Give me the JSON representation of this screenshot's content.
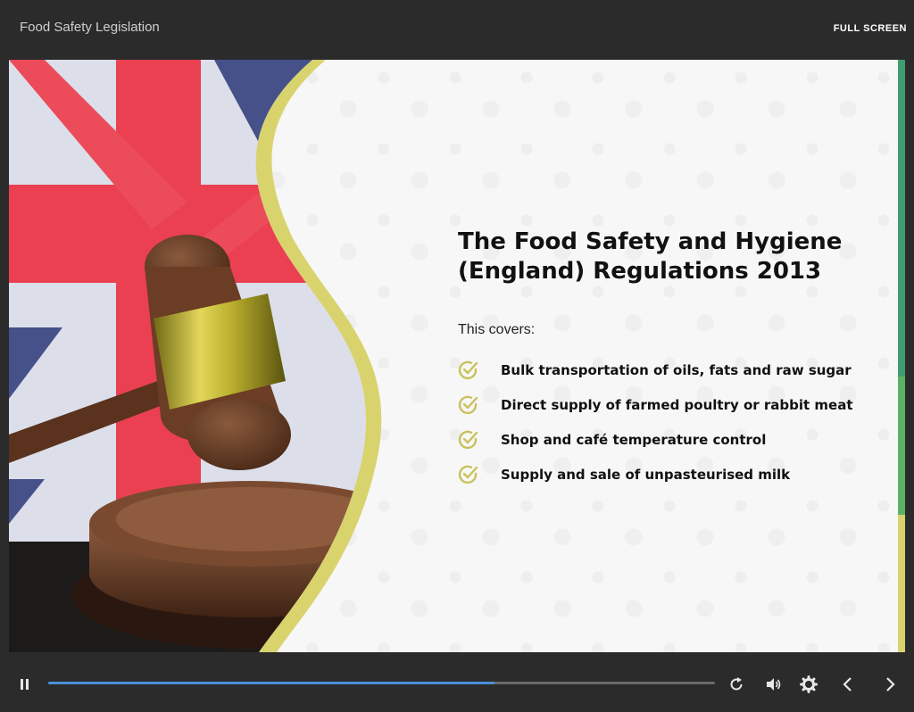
{
  "app": {
    "title": "Food Safety Legislation",
    "fullscreen_label": "FULL SCREEN"
  },
  "slide": {
    "title_line1": "The Food Safety and Hygiene",
    "title_line2": "(England) Regulations 2013",
    "intro": "This covers:",
    "bullets": [
      "Bulk transportation of oils, fats and raw sugar",
      "Direct supply of farmed poultry or rabbit meat",
      "Shop and café temperature control",
      "Supply and sale of unpasteurised milk"
    ],
    "accent_color": "#d9d36e",
    "check_color": "#c9c15a"
  },
  "player": {
    "progress_fraction": 0.67,
    "progress_color": "#4a90d9",
    "icons": [
      "pause-icon",
      "replay-icon",
      "volume-icon",
      "settings-icon",
      "previous-icon",
      "next-icon"
    ]
  }
}
